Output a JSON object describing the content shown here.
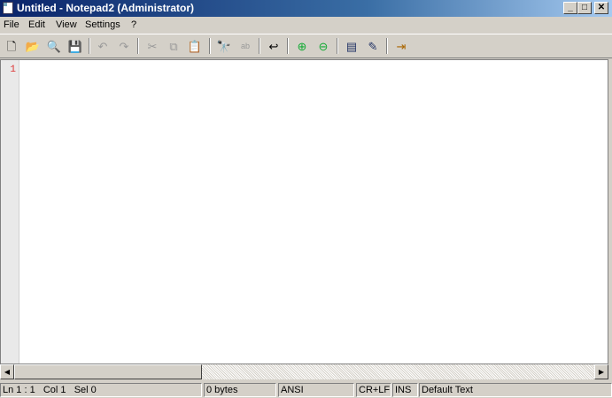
{
  "window": {
    "title": "Untitled - Notepad2 (Administrator)"
  },
  "window_controls": {
    "minimize": "_",
    "maximize": "□",
    "close": "✕"
  },
  "menu": [
    "File",
    "Edit",
    "View",
    "Settings",
    "?"
  ],
  "toolbar": [
    {
      "name": "new-icon",
      "glyph": "🗋"
    },
    {
      "name": "open-icon",
      "glyph": "📂"
    },
    {
      "name": "browse-icon",
      "glyph": "🔍"
    },
    {
      "name": "save-icon",
      "glyph": "💾"
    },
    {
      "name": "undo-icon",
      "glyph": "↶"
    },
    {
      "name": "redo-icon",
      "glyph": "↷"
    },
    {
      "name": "cut-icon",
      "glyph": "✂"
    },
    {
      "name": "copy-icon",
      "glyph": "⧉"
    },
    {
      "name": "paste-icon",
      "glyph": "📋"
    },
    {
      "name": "find-icon",
      "glyph": "🔭"
    },
    {
      "name": "replace-icon",
      "glyph": "ab"
    },
    {
      "name": "wordwrap-icon",
      "glyph": "↩"
    },
    {
      "name": "zoom-in-icon",
      "glyph": "⊕"
    },
    {
      "name": "zoom-out-icon",
      "glyph": "⊖"
    },
    {
      "name": "scheme-icon",
      "glyph": "▤"
    },
    {
      "name": "customize-icon",
      "glyph": "✎"
    },
    {
      "name": "exit-icon",
      "glyph": "⇥"
    }
  ],
  "editor": {
    "line_number": "1"
  },
  "scrollbar": {
    "left": "◀",
    "right": "▶"
  },
  "status": {
    "position": "Ln 1 : 1   Col 1   Sel 0",
    "size": "0 bytes",
    "encoding": "ANSI",
    "eol": "CR+LF",
    "mode": "INS",
    "lexer": "Default Text"
  }
}
